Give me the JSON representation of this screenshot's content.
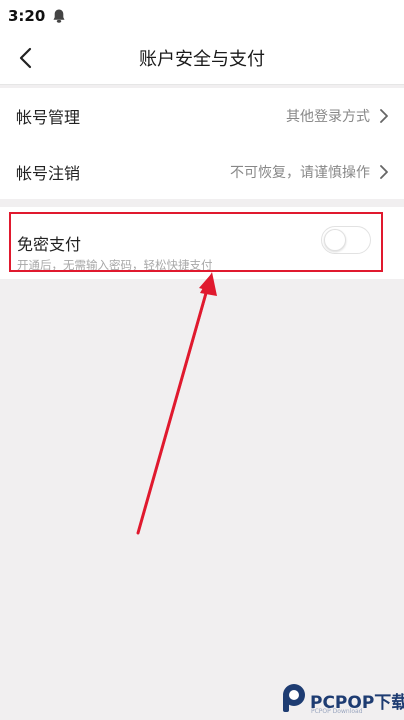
{
  "status_bar": {
    "time": "3:20"
  },
  "header": {
    "title": "账户安全与支付"
  },
  "settings": {
    "rows": [
      {
        "label": "帐号管理",
        "value": "其他登录方式"
      },
      {
        "label": "帐号注销",
        "value": "不可恢复，请谨慎操作"
      }
    ]
  },
  "password_free_payment": {
    "title": "免密支付",
    "subtitle": "开通后，无需输入密码，轻松快捷支付",
    "enabled": false
  },
  "annotation": {
    "highlight_color": "#e0192e"
  },
  "watermark": {
    "brand": "PCPOP下载",
    "sub": "PCPOP Download"
  },
  "colors": {
    "background": "#f1eff0",
    "card": "#ffffff",
    "text_primary": "#222222",
    "text_secondary": "#888888"
  }
}
